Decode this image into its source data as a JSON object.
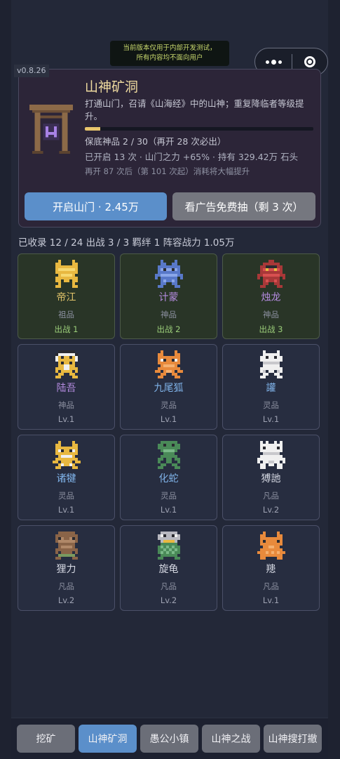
{
  "notice": {
    "line1": "当前版本仅用于内部开发测试，",
    "line2": "所有内容均不面向用户"
  },
  "capsule": {
    "menu_icon": "more-dots-icon",
    "close_icon": "target-circle-icon"
  },
  "version": "v0.8.26",
  "gate": {
    "icon": "shrine-gate-icon",
    "title": "山神矿洞",
    "description": "打通山门，召请《山海经》中的山神；重复降临者等级提升。",
    "pity_progress": 0.0667,
    "pity_text": "保底神品 2 / 30（再开 28 次必出）",
    "stats_text": "已开启 13 次 · 山门之力 +65% · 持有 329.42万 石头",
    "cost_text": "再开 87 次后（第 101 次起）消耗将大幅提升",
    "open_button": "开启山门 · 2.45万",
    "ad_button": "看广告免费抽（剩 3 次）"
  },
  "summary": "已收录 12 / 24   出战 3 / 3   羁绊 1   阵容战力 1.05万",
  "colors": {
    "grade_zushen": "#e3c56a",
    "grade_shenpin": "#b58ce0",
    "grade_lingpin": "#7fb2e8",
    "grade_fanpin": "#d5d8e2",
    "accent_blue": "#5b8fca"
  },
  "heroes": [
    {
      "name": "帝江",
      "grade": "祖品",
      "state": "出战 1",
      "active": true,
      "color": "#e3c56a",
      "sprite": "dijiang"
    },
    {
      "name": "计蒙",
      "grade": "神品",
      "state": "出战 2",
      "active": true,
      "color": "#b58ce0",
      "sprite": "jimeng"
    },
    {
      "name": "烛龙",
      "grade": "神品",
      "state": "出战 3",
      "active": true,
      "color": "#b58ce0",
      "sprite": "zhulong"
    },
    {
      "name": "陆吾",
      "grade": "神品",
      "state": "Lv.1",
      "active": false,
      "color": "#b58ce0",
      "sprite": "luwu"
    },
    {
      "name": "九尾狐",
      "grade": "灵品",
      "state": "Lv.1",
      "active": false,
      "color": "#7fb2e8",
      "sprite": "jiuweihu"
    },
    {
      "name": "讙",
      "grade": "灵品",
      "state": "Lv.1",
      "active": false,
      "color": "#7fb2e8",
      "sprite": "huan"
    },
    {
      "name": "诸犍",
      "grade": "灵品",
      "state": "Lv.1",
      "active": false,
      "color": "#7fb2e8",
      "sprite": "zhujian"
    },
    {
      "name": "化蛇",
      "grade": "灵品",
      "state": "Lv.1",
      "active": false,
      "color": "#7fb2e8",
      "sprite": "huashe"
    },
    {
      "name": "猼訑",
      "grade": "凡品",
      "state": "Lv.2",
      "active": false,
      "color": "#d5d8e2",
      "sprite": "boyi"
    },
    {
      "name": "狸力",
      "grade": "凡品",
      "state": "Lv.2",
      "active": false,
      "color": "#d5d8e2",
      "sprite": "lili"
    },
    {
      "name": "旋龟",
      "grade": "凡品",
      "state": "Lv.2",
      "active": false,
      "color": "#d5d8e2",
      "sprite": "xuangui"
    },
    {
      "name": "䍺",
      "grade": "凡品",
      "state": "Lv.1",
      "active": false,
      "color": "#d5d8e2",
      "sprite": "yuan"
    }
  ],
  "tabs": [
    {
      "label": "挖矿",
      "active": false
    },
    {
      "label": "山神矿洞",
      "active": true
    },
    {
      "label": "愚公小镇",
      "active": false
    },
    {
      "label": "山神之战",
      "active": false
    },
    {
      "label": "山神搜打撤",
      "active": false
    }
  ]
}
